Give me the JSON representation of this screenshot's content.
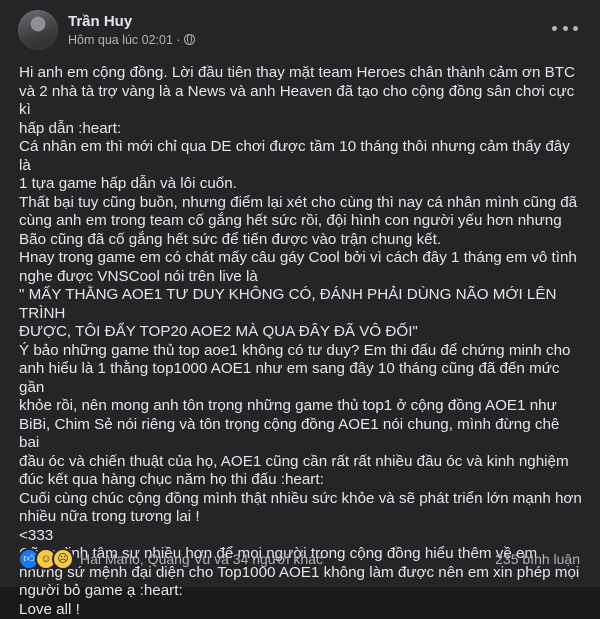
{
  "post": {
    "author": "Trần Huy",
    "time": "Hôm qua lúc 02:01 ·",
    "privacy_icon": "globe-icon",
    "more_icon": "more-options-icon",
    "lines": [
      "Hi anh em cộng đồng. Lời đầu tiên thay mặt team Heroes chân thành cảm ơn BTC",
      "và 2 nhà tà trợ vàng là a News và anh Heaven đã tạo cho cộng đồng sân chơi cực kì",
      "hấp dẫn :heart:",
      "Cá nhân em thì mới chỉ qua DE chơi được tầm 10 tháng thôi nhưng cảm thấy đây là",
      "1 tựa game hấp dẫn và lôi cuốn.",
      "Thất bại tuy cũng buồn, nhưng điểm lại xét cho cùng thì nay cá nhân mình cũng đã",
      "cùng anh em trong team cố gắng hết sức rồi, đội hình con người yếu hơn nhưng",
      "Bão cũng đã cố gắng hết sức để tiến được vào trận chung kết.",
      "Hnay trong game em có chát mấy câu gáy Cool bởi vì cách đây 1 tháng em vô tình",
      "nghe được VNSCool nói trên live là",
      "\" MẤY THẰNG AOE1 TƯ DUY KHÔNG CÓ, ĐÁNH PHẢI DÙNG NÃO MỚI LÊN TRÌNH",
      "ĐƯỢC, TÔI ĐẨY TOP20 AOE2 MÀ QUA ĐÂY ĐÃ VÔ ĐỐI\"",
      "Ý bảo những game thủ top aoe1 không có tư duy? Em thi đấu để chứng minh cho",
      "anh hiểu là 1 thằng top1000 AOE1 như em sang đây 10 tháng cũng đã đến mức gần",
      "khỏe rồi, nên mong anh tôn trọng những game thủ top1 ở cộng đồng AOE1 như",
      "BiBi, Chim Sẻ nói riêng và tôn trọng cộng đồng AOE1 nói chung, mình đừng chê bai",
      "đầu óc và chiến thuật của họ, AOE1 cũng cần rất rất nhiều đầu óc và kinh nghiệm",
      "đúc kết qua hàng chục năm họ thi đấu :heart:",
      "Cuối cùng chúc cộng đồng mình thật nhiều sức khỏe và sẽ phát triển lớn mạnh hơn",
      "nhiều nữa trong tương lai !",
      "<333",
      "Cũng định tâm sự nhiều hơn để mọi người trong cộng đồng hiểu thêm về em",
      "nhưng sứ mệnh đại diện cho Top1000 AOE1 không làm được nên em xin phép mọi",
      "người bỏ game ạ :heart:",
      "Love all !"
    ],
    "reactions": {
      "icons": [
        "like-icon",
        "haha-icon",
        "sad-icon"
      ],
      "names": "Hải Mario, Quang Vu và 34 người khác"
    },
    "comments": "235 bình luận"
  }
}
